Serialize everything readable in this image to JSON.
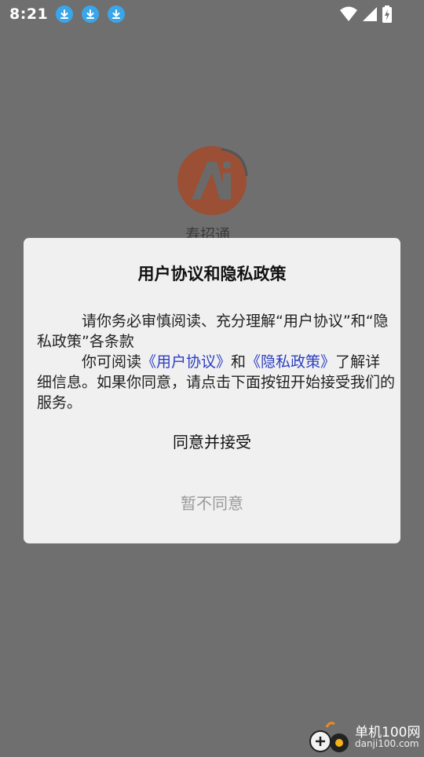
{
  "status_bar": {
    "time": "8:21",
    "icons": [
      "download-icon",
      "download-icon",
      "download-icon",
      "wifi-icon",
      "signal-icon",
      "battery-charging-icon"
    ]
  },
  "app": {
    "name": "寿招通"
  },
  "dialog": {
    "title": "用户协议和隐私政策",
    "line1": "请你务必审慎阅读、充分理解“用户协议”和“隐私政策”各条款",
    "line2_prefix": "你可阅读",
    "link_user_agreement": "《用户协议》",
    "line2_and": "和",
    "link_privacy_policy": "《隐私政策》",
    "line2_suffix": "了解详细信息。如果你同意，请点击下面按钮开始接受我们的服务。",
    "agree_label": "同意并接受",
    "decline_label": "暂不同意"
  },
  "watermark": {
    "cn": "单机100网",
    "en": "danji100.com"
  },
  "colors": {
    "overlay": "#6f6f6f",
    "dialog_bg": "#f0f0f0",
    "link": "#2c3ec2",
    "download_badge": "#3aa6ea",
    "logo": "#d4471f"
  }
}
